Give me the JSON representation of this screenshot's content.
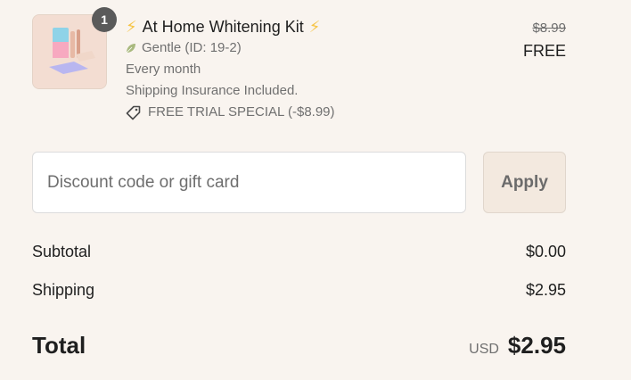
{
  "product": {
    "quantity": "1",
    "title": "At Home Whitening Kit",
    "bolt_left": "⚡",
    "bolt_right": "⚡",
    "variant": "Gentle (ID: 19-2)",
    "frequency": "Every month",
    "insurance": "Shipping Insurance Included.",
    "discount_tag": "FREE TRIAL SPECIAL (-$8.99)",
    "original_price": "$8.99",
    "price": "FREE",
    "icons": {
      "leaf": "leaf-icon",
      "tag": "tag-icon",
      "bolt": "lightning-bolt-icon"
    }
  },
  "discount": {
    "placeholder": "Discount code or gift card",
    "apply_label": "Apply"
  },
  "summary": {
    "subtotal_label": "Subtotal",
    "subtotal_value": "$0.00",
    "shipping_label": "Shipping",
    "shipping_value": "$2.95",
    "total_label": "Total",
    "currency": "USD",
    "total_value": "$2.95"
  },
  "colors": {
    "background": "#f9f4ef",
    "badge": "#5a5a5a",
    "apply_button": "#f3e9df",
    "bolt": "#f6c445"
  }
}
